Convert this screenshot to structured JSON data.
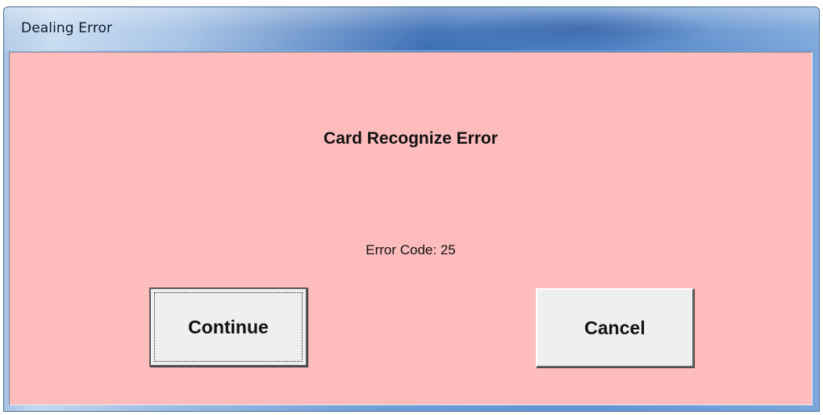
{
  "window": {
    "title": "Dealing Error"
  },
  "dialog": {
    "heading": "Card Recognize Error",
    "error_code_text": "Error Code: 25",
    "background_color": "#ffbcbc"
  },
  "buttons": {
    "continue_label": "Continue",
    "cancel_label": "Cancel",
    "focused": "Continue"
  }
}
